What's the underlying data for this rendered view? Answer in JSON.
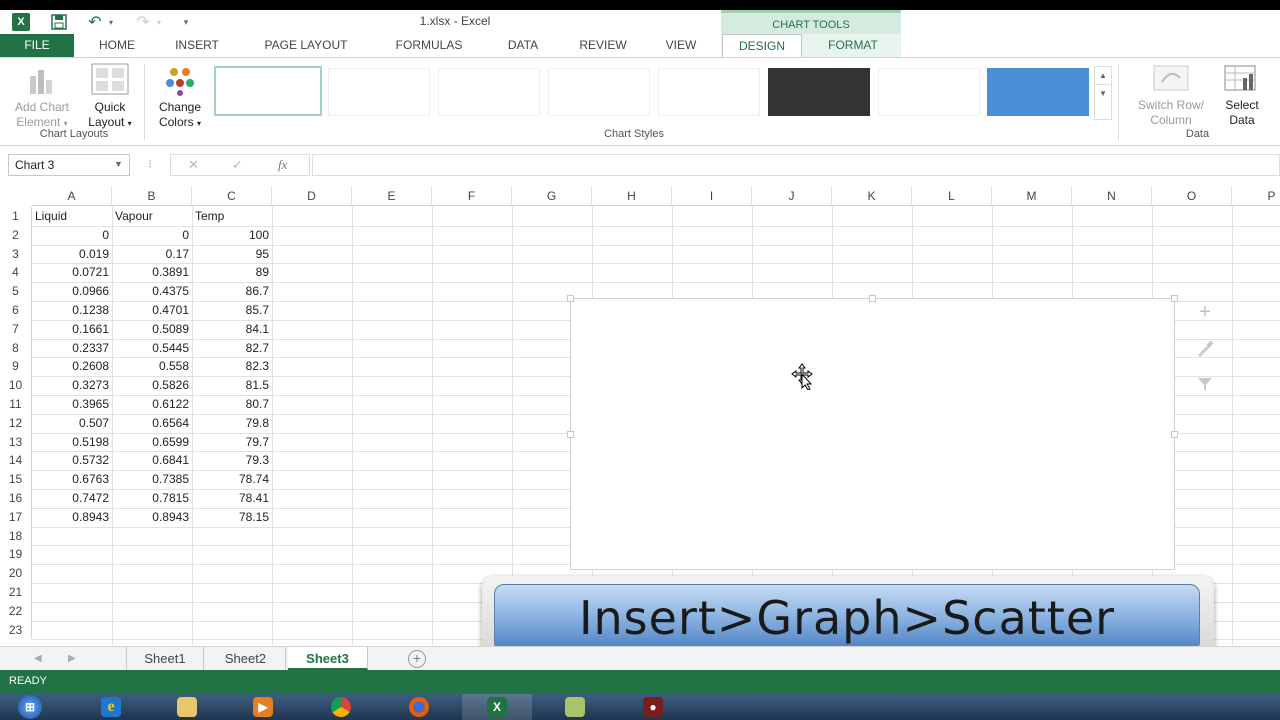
{
  "titlebar": {
    "title": "1.xlsx - Excel",
    "contextual_tab": "CHART TOOLS",
    "app_icon": "X",
    "qat_icons": [
      "save-icon",
      "undo-icon",
      "redo-icon",
      "customize-icon"
    ]
  },
  "tabs": {
    "file": "FILE",
    "home": "HOME",
    "insert": "INSERT",
    "page_layout": "PAGE LAYOUT",
    "formulas": "FORMULAS",
    "data": "DATA",
    "review": "REVIEW",
    "view": "VIEW",
    "design": "DESIGN",
    "format": "FORMAT"
  },
  "ribbon": {
    "add_chart_element": [
      "Add Chart",
      "Element"
    ],
    "quick_layout": [
      "Quick",
      "Layout"
    ],
    "change_colors": [
      "Change",
      "Colors"
    ],
    "switch_row_column": [
      "Switch Row/",
      "Column"
    ],
    "select_data": [
      "Select",
      "Data"
    ],
    "groups": {
      "chart_layouts": "Chart Layouts",
      "chart_styles": "Chart Styles",
      "data": "Data"
    }
  },
  "formula_bar": {
    "name_box": "Chart 3",
    "fx": "fx",
    "cancel": "✕",
    "enter": "✓",
    "content": ""
  },
  "grid": {
    "columns": [
      "A",
      "B",
      "C",
      "D",
      "E",
      "F",
      "G",
      "H",
      "I",
      "J",
      "K",
      "L",
      "M",
      "N",
      "O",
      "P"
    ],
    "rows": [
      "1",
      "2",
      "3",
      "4",
      "5",
      "6",
      "7",
      "8",
      "9",
      "10",
      "11",
      "12",
      "13",
      "14",
      "15",
      "16",
      "17",
      "18",
      "19",
      "20",
      "21",
      "22",
      "23"
    ],
    "header": [
      "Liquid",
      "Vapour",
      "Temp"
    ],
    "data": [
      [
        "0",
        "0",
        "100"
      ],
      [
        "0.019",
        "0.17",
        "95"
      ],
      [
        "0.0721",
        "0.3891",
        "89"
      ],
      [
        "0.0966",
        "0.4375",
        "86.7"
      ],
      [
        "0.1238",
        "0.4701",
        "85.7"
      ],
      [
        "0.1661",
        "0.5089",
        "84.1"
      ],
      [
        "0.2337",
        "0.5445",
        "82.7"
      ],
      [
        "0.2608",
        "0.558",
        "82.3"
      ],
      [
        "0.3273",
        "0.5826",
        "81.5"
      ],
      [
        "0.3965",
        "0.6122",
        "80.7"
      ],
      [
        "0.507",
        "0.6564",
        "79.8"
      ],
      [
        "0.5198",
        "0.6599",
        "79.7"
      ],
      [
        "0.5732",
        "0.6841",
        "79.3"
      ],
      [
        "0.6763",
        "0.7385",
        "78.74"
      ],
      [
        "0.7472",
        "0.7815",
        "78.41"
      ],
      [
        "0.8943",
        "0.8943",
        "78.15"
      ]
    ]
  },
  "chart": {
    "name": "Chart 3",
    "tools": [
      "chart-elements-icon",
      "chart-styles-icon",
      "chart-filters-icon"
    ]
  },
  "caption": "Insert>Graph>Scatter",
  "sheets": [
    "Sheet1",
    "Sheet2",
    "Sheet3"
  ],
  "active_sheet": "Sheet3",
  "status": "READY",
  "taskbar_items": [
    "start-button",
    "internet-explorer-icon",
    "file-explorer-icon",
    "media-player-icon",
    "chrome-icon",
    "firefox-icon",
    "excel-taskbar-icon",
    "app-taskbar-icon",
    "recorder-taskbar-icon"
  ],
  "colors": {
    "accent": "#217346",
    "context_tab_bg": "#d6ebdf",
    "caption_blue": "#4a7fc2"
  }
}
